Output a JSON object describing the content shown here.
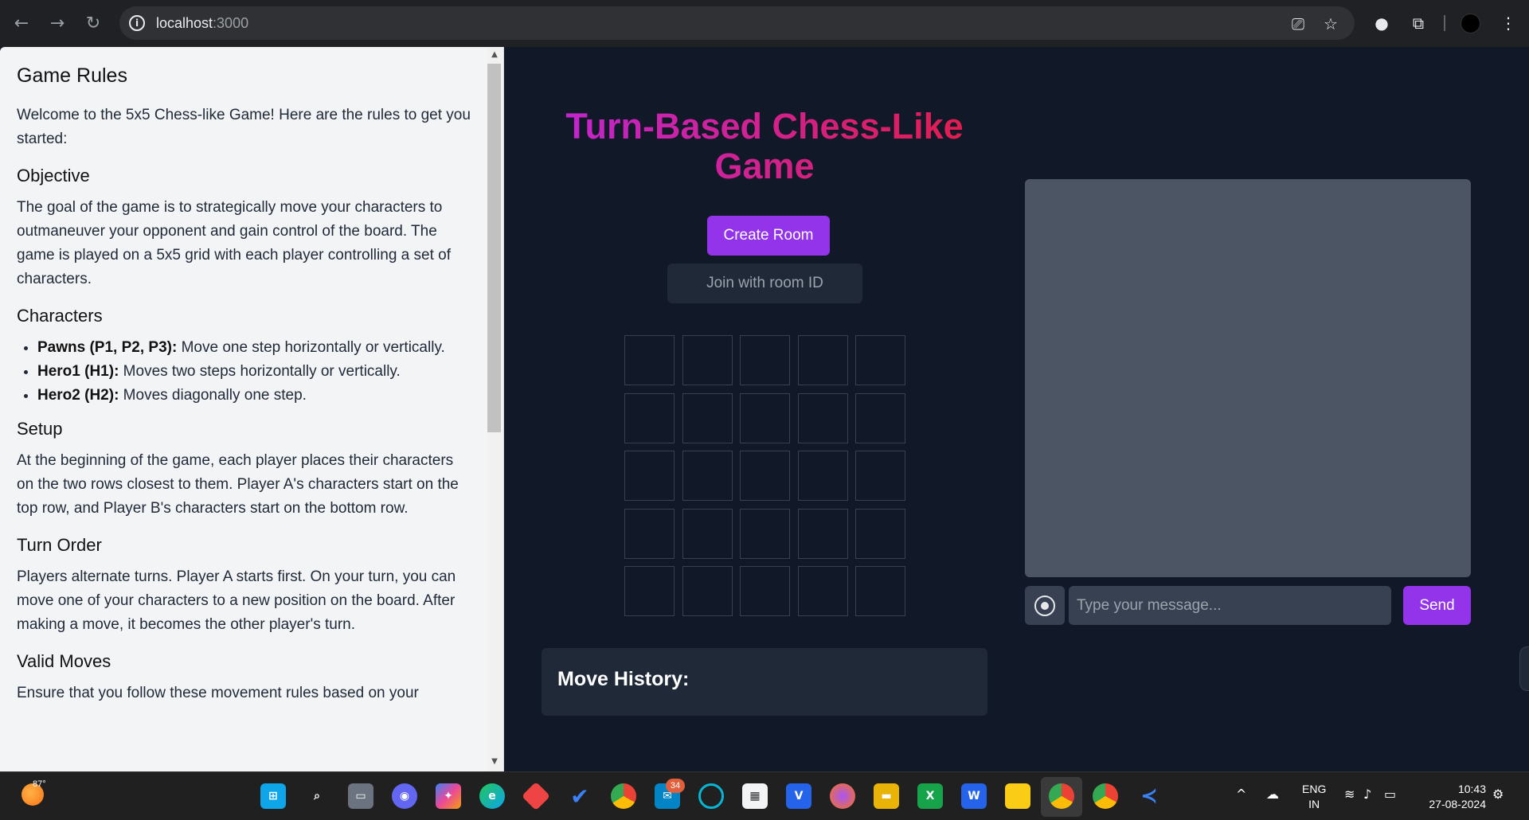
{
  "browser": {
    "url_host": "localhost",
    "url_port": ":3000"
  },
  "rules": {
    "title": "Game Rules",
    "intro": "Welcome to the 5x5 Chess-like Game! Here are the rules to get you started:",
    "objective_heading": "Objective",
    "objective_text": "The goal of the game is to strategically move your characters to outmaneuver your opponent and gain control of the board. The game is played on a 5x5 grid with each player controlling a set of characters.",
    "characters_heading": "Characters",
    "characters": [
      {
        "name": "Pawns (P1, P2, P3):",
        "desc": " Move one step horizontally or vertically."
      },
      {
        "name": "Hero1 (H1):",
        "desc": " Moves two steps horizontally or vertically."
      },
      {
        "name": "Hero2 (H2):",
        "desc": " Moves diagonally one step."
      }
    ],
    "setup_heading": "Setup",
    "setup_text": "At the beginning of the game, each player places their characters on the two rows closest to them. Player A's characters start on the top row, and Player B's characters start on the bottom row.",
    "turn_heading": "Turn Order",
    "turn_text": "Players alternate turns. Player A starts first. On your turn, you can move one of your characters to a new position on the board. After making a move, it becomes the other player's turn.",
    "valid_heading": "Valid Moves",
    "valid_text": "Ensure that you follow these movement rules based on your"
  },
  "game": {
    "title": "Turn-Based Chess-Like Game",
    "create_room": "Create Room",
    "join_room": "Join with room ID",
    "move_history": "Move History:"
  },
  "chat": {
    "placeholder": "Type your message...",
    "send": "Send"
  },
  "taskbar": {
    "temp": "87°",
    "mail_badge": "34",
    "lang_top": "ENG",
    "lang_bottom": "IN",
    "time": "10:43",
    "date": "27-08-2024"
  }
}
